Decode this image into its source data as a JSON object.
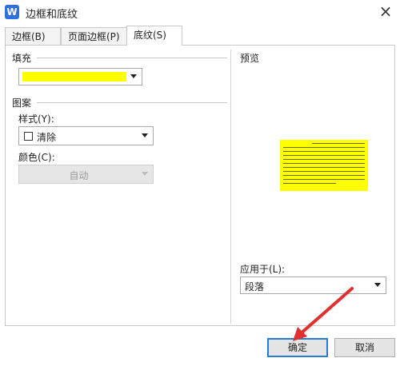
{
  "window": {
    "title": "边框和底纹",
    "app_icon": "W",
    "close_glyph": "×"
  },
  "tabs": [
    {
      "label": "边框(B)"
    },
    {
      "label": "页面边框(P)"
    },
    {
      "label": "底纹(S)"
    }
  ],
  "fill": {
    "section_label": "填充",
    "color": "#ffff00"
  },
  "pattern": {
    "section_label": "图案",
    "style_label": "样式(Y):",
    "style_value": "清除",
    "color_label": "颜色(C):",
    "color_value": "自动"
  },
  "preview": {
    "label": "预览",
    "fill_color": "#ffff00"
  },
  "apply": {
    "label": "应用于(L):",
    "value": "段落"
  },
  "buttons": {
    "ok": "确定",
    "cancel": "取消"
  }
}
